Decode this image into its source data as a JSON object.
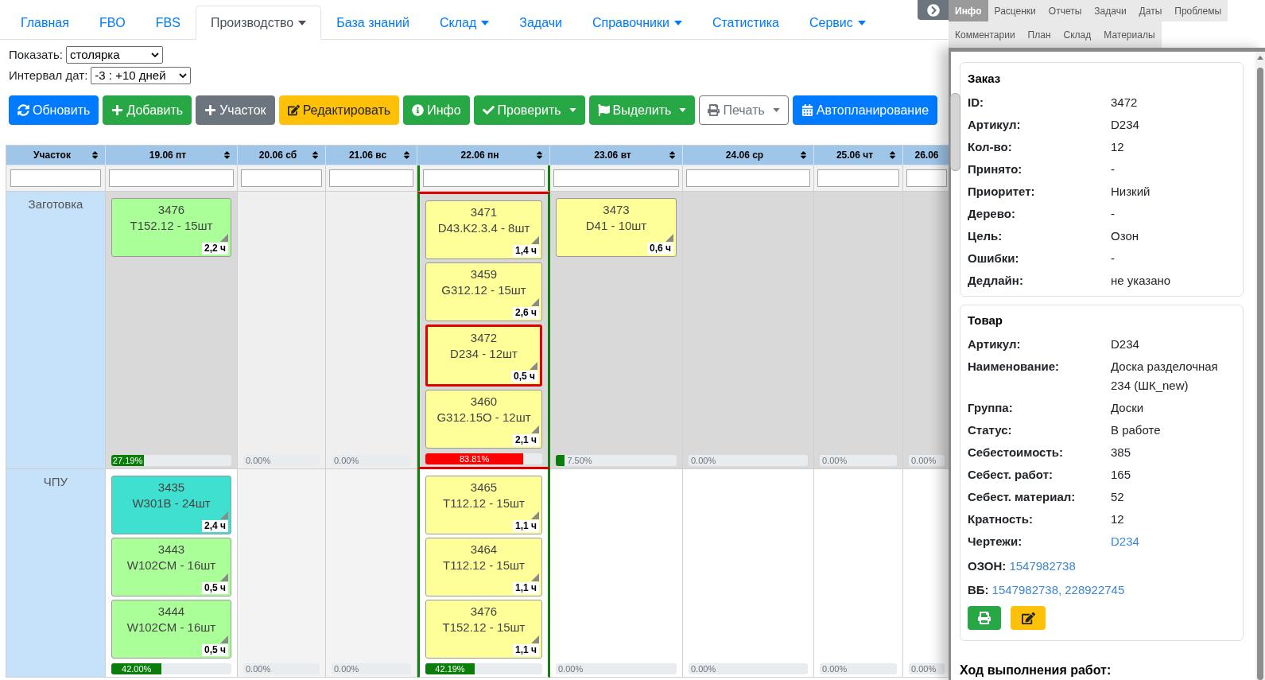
{
  "nav": {
    "tabs": [
      {
        "label": "Главная",
        "selected": false,
        "dropdown": false
      },
      {
        "label": "FBO",
        "selected": false,
        "dropdown": false
      },
      {
        "label": "FBS",
        "selected": false,
        "dropdown": false
      },
      {
        "label": "Производство",
        "selected": true,
        "dropdown": true
      },
      {
        "label": "База знаний",
        "selected": false,
        "dropdown": false
      },
      {
        "label": "Склад",
        "selected": false,
        "dropdown": true
      },
      {
        "label": "Задачи",
        "selected": false,
        "dropdown": false
      },
      {
        "label": "Справочники",
        "selected": false,
        "dropdown": true
      },
      {
        "label": "Статистика",
        "selected": false,
        "dropdown": false
      },
      {
        "label": "Сервис",
        "selected": false,
        "dropdown": true
      }
    ]
  },
  "filters": [
    {
      "label": "Показать:",
      "value": "столярка"
    },
    {
      "label": "Интервал дат:",
      "value": "-3 : +10 дней"
    }
  ],
  "toolbar": [
    {
      "label": "Обновить",
      "kind": "primary",
      "dropdown": false
    },
    {
      "label": "Добавить",
      "kind": "success",
      "dropdown": false
    },
    {
      "label": "Участок",
      "kind": "secondary",
      "dropdown": false
    },
    {
      "label": "Редактировать",
      "kind": "warning",
      "dropdown": false
    },
    {
      "label": "Инфо",
      "kind": "success",
      "dropdown": false
    },
    {
      "label": "Проверить",
      "kind": "success",
      "dropdown": true
    },
    {
      "label": "Выделить",
      "kind": "success",
      "dropdown": true
    },
    {
      "label": "Печать",
      "kind": "outline",
      "dropdown": true
    },
    {
      "label": "Автопланирование",
      "kind": "primary",
      "dropdown": false
    }
  ],
  "table": {
    "section_column": {
      "label": "Участок"
    },
    "day_columns": [
      {
        "label": "19.06 пт",
        "weekend": false,
        "today": false,
        "clipped": false
      },
      {
        "label": "20.06 сб",
        "weekend": true,
        "today": false,
        "clipped": false
      },
      {
        "label": "21.06 вс",
        "weekend": true,
        "today": false,
        "clipped": false
      },
      {
        "label": "22.06 пн",
        "weekend": false,
        "today": true,
        "clipped": false
      },
      {
        "label": "23.06 вт",
        "weekend": false,
        "today": false,
        "clipped": false
      },
      {
        "label": "24.06 ср",
        "weekend": false,
        "today": false,
        "clipped": false
      },
      {
        "label": "25.06 чт",
        "weekend": false,
        "today": false,
        "clipped": false
      },
      {
        "label": "26.06",
        "weekend": false,
        "today": false,
        "clipped": true
      }
    ],
    "rows": [
      {
        "label": "Заготовка",
        "selected": true,
        "cells": [
          {
            "overloaded": false,
            "load": {
              "level": 0.2719,
              "reading": "27.19%"
            },
            "cards": [
              {
                "number": "3476",
                "title": "T152.12 - 15шт",
                "hours": "2,2 ч",
                "color": "#aaff99",
                "selected": false
              }
            ]
          },
          {
            "overloaded": false,
            "load": {
              "level": 0,
              "reading": "0.00%"
            }
          },
          {
            "overloaded": false,
            "load": {
              "level": 0,
              "reading": "0.00%"
            }
          },
          {
            "overloaded": true,
            "load": {
              "level": 0.8381,
              "reading": "83.81%"
            },
            "cards": [
              {
                "number": "3471",
                "title": "D43.K2.3.4 - 8шт",
                "hours": "1,4 ч",
                "color": "#ffff99",
                "selected": false
              },
              {
                "number": "3459",
                "title": "G312.12 - 15шт",
                "hours": "2,6 ч",
                "color": "#ffff99",
                "selected": false
              },
              {
                "number": "3472",
                "title": "D234 - 12шт",
                "hours": "0,5 ч",
                "color": "#ffff99",
                "selected": true
              },
              {
                "number": "3460",
                "title": "G312.15O - 12шт",
                "hours": "2,1 ч",
                "color": "#ffff99",
                "selected": false
              }
            ]
          },
          {
            "overloaded": false,
            "load": {
              "level": 0.075,
              "reading": "7.50%"
            },
            "cards": [
              {
                "number": "3473",
                "title": "D41 - 10шт",
                "hours": "0,6 ч",
                "color": "#ffff99",
                "selected": false
              }
            ]
          },
          {
            "overloaded": false,
            "load": {
              "level": 0,
              "reading": "0.00%"
            }
          },
          {
            "overloaded": false,
            "load": {
              "level": 0,
              "reading": "0.00%"
            }
          },
          {
            "overloaded": false,
            "load": {
              "level": 0,
              "reading": "0.00%"
            }
          }
        ]
      },
      {
        "label": "ЧПУ",
        "selected": false,
        "cells": [
          {
            "overloaded": false,
            "load": {
              "level": 0.42,
              "reading": "42.00%"
            },
            "cards": [
              {
                "number": "3435",
                "title": "W301B - 24шт",
                "hours": "2,4 ч",
                "color": "#40e0d0",
                "selected": false
              },
              {
                "number": "3443",
                "title": "W102CM - 16шт",
                "hours": "0,5 ч",
                "color": "#aaff99",
                "selected": false
              },
              {
                "number": "3444",
                "title": "W102CM - 16шт",
                "hours": "0,5 ч",
                "color": "#aaff99",
                "selected": false
              }
            ]
          },
          {
            "overloaded": false,
            "load": {
              "level": 0,
              "reading": "0.00%"
            }
          },
          {
            "overloaded": false,
            "load": {
              "level": 0,
              "reading": "0.00%"
            }
          },
          {
            "overloaded": false,
            "load": {
              "level": 0.4219,
              "reading": "42.19%"
            },
            "cards": [
              {
                "number": "3465",
                "title": "T112.12 - 15шт",
                "hours": "1,1 ч",
                "color": "#ffff99",
                "selected": false
              },
              {
                "number": "3464",
                "title": "T112.12 - 15шт",
                "hours": "1,1 ч",
                "color": "#ffff99",
                "selected": false
              },
              {
                "number": "3476",
                "title": "T152.12 - 15шт",
                "hours": "1,1 ч",
                "color": "#ffff99",
                "selected": false
              }
            ]
          },
          {
            "overloaded": false,
            "load": {
              "level": 0,
              "reading": "0.00%"
            }
          },
          {
            "overloaded": false,
            "load": {
              "level": 0,
              "reading": "0.00%"
            }
          },
          {
            "overloaded": false,
            "load": {
              "level": 0,
              "reading": "0.00%"
            }
          },
          {
            "overloaded": false,
            "load": {
              "level": 0,
              "reading": "0.00%"
            }
          }
        ]
      }
    ]
  },
  "panel": {
    "tab_rows": [
      [
        {
          "label": "Инфо",
          "selected": true
        },
        {
          "label": "Расценки",
          "selected": false
        },
        {
          "label": "Отчеты",
          "selected": false
        },
        {
          "label": "Задачи",
          "selected": false
        },
        {
          "label": "Даты",
          "selected": false
        },
        {
          "label": "Проблемы",
          "selected": false
        }
      ],
      [
        {
          "label": "Комментарии",
          "selected": false
        },
        {
          "label": "План",
          "selected": false
        },
        {
          "label": "Склад",
          "selected": false
        },
        {
          "label": "Материалы",
          "selected": false
        }
      ]
    ],
    "sections": [
      {
        "title": "Заказ",
        "fields": [
          {
            "label": "ID:",
            "value": "3472",
            "kind": "text"
          },
          {
            "label": "Артикул:",
            "value": "D234",
            "kind": "text"
          },
          {
            "label": "Кол-во:",
            "value": "12",
            "kind": "text"
          },
          {
            "label": "Принято:",
            "value": "-",
            "kind": "text"
          },
          {
            "label": "Приоритет:",
            "value": "Низкий",
            "kind": "text"
          },
          {
            "label": "Дерево:",
            "value": "-",
            "kind": "text"
          },
          {
            "label": "Цель:",
            "value": "Озон",
            "kind": "text"
          },
          {
            "label": "Ошибки:",
            "value": "-",
            "kind": "text"
          },
          {
            "label": "Дедлайн:",
            "value": "не указано",
            "kind": "text"
          }
        ]
      },
      {
        "title": "Товар",
        "fields": [
          {
            "label": "Артикул:",
            "value": "D234",
            "kind": "text"
          },
          {
            "label": "Наименование:",
            "value": "Доска разделочная 234 (ШК_new)",
            "kind": "text"
          },
          {
            "label": "Группа:",
            "value": "Доски",
            "kind": "text"
          },
          {
            "label": "Статус:",
            "value": "В работе",
            "kind": "text"
          },
          {
            "label": "Себестоимость:",
            "value": "385",
            "kind": "text"
          },
          {
            "label": "Себест. работ:",
            "value": "165",
            "kind": "text"
          },
          {
            "label": "Себест. материал:",
            "value": "52",
            "kind": "text"
          },
          {
            "label": "Кратность:",
            "value": "12",
            "kind": "text"
          },
          {
            "label": "Чертежи:",
            "value": "D234",
            "kind": "link"
          }
        ],
        "marketplaces": [
          {
            "label": "ОЗОН:",
            "links": [
              "1547982738"
            ]
          },
          {
            "label": "ВБ:",
            "links": [
              "1547982738,",
              "228922745"
            ]
          }
        ],
        "actions": [
          {
            "kind": "print"
          },
          {
            "kind": "edit"
          }
        ]
      }
    ],
    "progress_heading": "Ход выполнения работ:"
  }
}
